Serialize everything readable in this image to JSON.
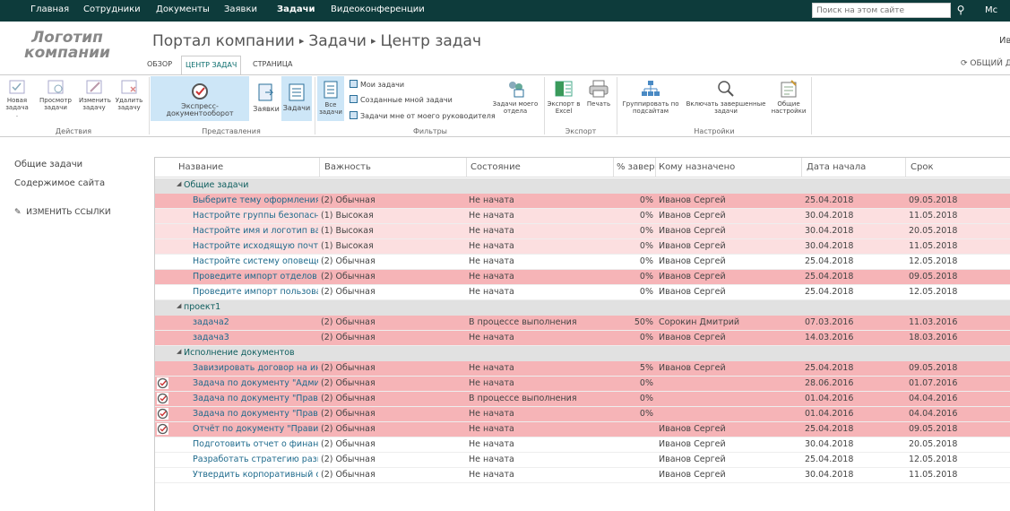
{
  "topnav": {
    "items": [
      "Главная",
      "Сотрудники",
      "Документы",
      "Заявки",
      "Задачи",
      "Видеоконференции"
    ],
    "active_index": 4,
    "search_placeholder": "Поиск на этом сайте",
    "right_text": "Мс"
  },
  "logo": {
    "line1": "Логотип",
    "line2": "компании"
  },
  "breadcrumb": [
    "Портал компании",
    "Задачи",
    "Центр задач"
  ],
  "user_short": "Ив",
  "share_label": "ОБЩИЙ Д",
  "ribbon_tabs": [
    "ОБЗОР",
    "ЦЕНТР ЗАДАЧ",
    "СТРАНИЦА"
  ],
  "ribbon": {
    "actions": {
      "label": "Действия",
      "buttons": [
        {
          "l1": "Новая",
          "l2": "задача ."
        },
        {
          "l1": "Просмотр",
          "l2": "задачи"
        },
        {
          "l1": "Изменить",
          "l2": "задачу"
        },
        {
          "l1": "Удалить",
          "l2": "задачу"
        }
      ]
    },
    "views": {
      "label": "Представления",
      "buttons": [
        "Экспресс-документооборот",
        "Заявки",
        "Задачи"
      ]
    },
    "filters": {
      "label": "Фильтры",
      "all": {
        "l1": "Все",
        "l2": "задачи"
      },
      "items": [
        "Мои задачи",
        "Созданные мной задачи",
        "Задачи мне от моего руководителя"
      ],
      "dept": {
        "l1": "Задачи моего",
        "l2": "отдела"
      }
    },
    "export": {
      "label": "Экспорт",
      "excel": {
        "l1": "Экспорт в",
        "l2": "Excel"
      },
      "print": "Печать"
    },
    "settings": {
      "label": "Настройки",
      "group": {
        "l1": "Группировать по",
        "l2": "подсайтам"
      },
      "completed": {
        "l1": "Включать завершенные",
        "l2": "задачи"
      },
      "general": {
        "l1": "Общие",
        "l2": "настройки"
      }
    }
  },
  "leftnav": {
    "items": [
      "Общие задачи",
      "Содержимое сайта"
    ],
    "edit_links": "ИЗМЕНИТЬ ССЫЛКИ"
  },
  "table": {
    "headers": [
      "Название",
      "Важность",
      "Состояние",
      "% завер",
      "Кому назначено",
      "Дата начала",
      "Срок"
    ],
    "groups": [
      {
        "title": "Общие задачи",
        "rows": [
          {
            "name": "Выберите тему оформления п",
            "imp": "(2) Обычная",
            "state": "Не начата",
            "pct": "0%",
            "who": "Иванов Сергей",
            "start": "25.04.2018",
            "due": "09.05.2018",
            "bg": "#f6b4b7",
            "chk": false
          },
          {
            "name": "Настройте группы безопаснос",
            "imp": "(1) Высокая",
            "state": "Не начата",
            "pct": "0%",
            "who": "Иванов Сергей",
            "start": "30.04.2018",
            "due": "11.05.2018",
            "bg": "#fcdfe0",
            "chk": false
          },
          {
            "name": "Настройте имя и логотип ваш",
            "imp": "(1) Высокая",
            "state": "Не начата",
            "pct": "0%",
            "who": "Иванов Сергей",
            "start": "30.04.2018",
            "due": "20.05.2018",
            "bg": "#fcdfe0",
            "chk": false
          },
          {
            "name": "Настройте исходящую почту [",
            "imp": "(1) Высокая",
            "state": "Не начата",
            "pct": "0%",
            "who": "Иванов Сергей",
            "start": "30.04.2018",
            "due": "11.05.2018",
            "bg": "#fcdfe0",
            "chk": false
          },
          {
            "name": "Настройте систему оповещен",
            "imp": "(2) Обычная",
            "state": "Не начата",
            "pct": "0%",
            "who": "Иванов Сергей",
            "start": "25.04.2018",
            "due": "12.05.2018",
            "bg": "#ffffff",
            "chk": false
          },
          {
            "name": "Проведите импорт отделов в",
            "imp": "(2) Обычная",
            "state": "Не начата",
            "pct": "0%",
            "who": "Иванов Сергей",
            "start": "25.04.2018",
            "due": "09.05.2018",
            "bg": "#f6b4b7",
            "chk": false
          },
          {
            "name": "Проведите импорт пользоват",
            "imp": "(2) Обычная",
            "state": "Не начата",
            "pct": "0%",
            "who": "Иванов Сергей",
            "start": "25.04.2018",
            "due": "12.05.2018",
            "bg": "#ffffff",
            "chk": false
          }
        ]
      },
      {
        "title": "проект1",
        "rows": [
          {
            "name": "задача2",
            "imp": "(2) Обычная",
            "state": "В процессе выполнения",
            "pct": "50%",
            "who": "Сорокин Дмитрий",
            "start": "07.03.2016",
            "due": "11.03.2016",
            "bg": "#f6b4b7",
            "chk": false
          },
          {
            "name": "задача3",
            "imp": "(2) Обычная",
            "state": "Не начата",
            "pct": "0%",
            "who": "Иванов Сергей",
            "start": "14.03.2016",
            "due": "18.03.2016",
            "bg": "#f6b4b7",
            "chk": false
          }
        ]
      },
      {
        "title": "Исполнение документов",
        "rows": [
          {
            "name": "Завизировать договор на инт",
            "imp": "(2) Обычная",
            "state": "Не начата",
            "pct": "5%",
            "who": "Иванов Сергей",
            "start": "25.04.2018",
            "due": "09.05.2018",
            "bg": "#f6b4b7",
            "chk": false
          },
          {
            "name": "Задача по документу \"Админ",
            "imp": "(2) Обычная",
            "state": "Не начата",
            "pct": "0%",
            "who": "",
            "start": "28.06.2016",
            "due": "01.07.2016",
            "bg": "#f6b4b7",
            "chk": true
          },
          {
            "name": "Задача по документу \"Правил",
            "imp": "(2) Обычная",
            "state": "В процессе выполнения",
            "pct": "0%",
            "who": "",
            "start": "01.04.2016",
            "due": "04.04.2016",
            "bg": "#f6b4b7",
            "chk": true
          },
          {
            "name": "Задача по документу \"Правил",
            "imp": "(2) Обычная",
            "state": "Не начата",
            "pct": "0%",
            "who": "",
            "start": "01.04.2016",
            "due": "04.04.2016",
            "bg": "#f6b4b7",
            "chk": true
          },
          {
            "name": "Отчёт по документу \"Правила",
            "imp": "(2) Обычная",
            "state": "Не начата",
            "pct": "",
            "who": "Иванов Сергей",
            "start": "25.04.2018",
            "due": "09.05.2018",
            "bg": "#f6b4b7",
            "chk": true
          },
          {
            "name": "Подготовить отчет о финансо",
            "imp": "(2) Обычная",
            "state": "Не начата",
            "pct": "",
            "who": "Иванов Сергей",
            "start": "30.04.2018",
            "due": "20.05.2018",
            "bg": "#ffffff",
            "chk": false
          },
          {
            "name": "Разработать стратегию развит",
            "imp": "(2) Обычная",
            "state": "Не начата",
            "pct": "",
            "who": "Иванов Сергей",
            "start": "25.04.2018",
            "due": "12.05.2018",
            "bg": "#ffffff",
            "chk": false
          },
          {
            "name": "Утвердить корпоративный сти",
            "imp": "(2) Обычная",
            "state": "Не начата",
            "pct": "",
            "who": "Иванов Сергей",
            "start": "30.04.2018",
            "due": "11.05.2018",
            "bg": "#ffffff",
            "chk": false
          }
        ]
      }
    ]
  }
}
